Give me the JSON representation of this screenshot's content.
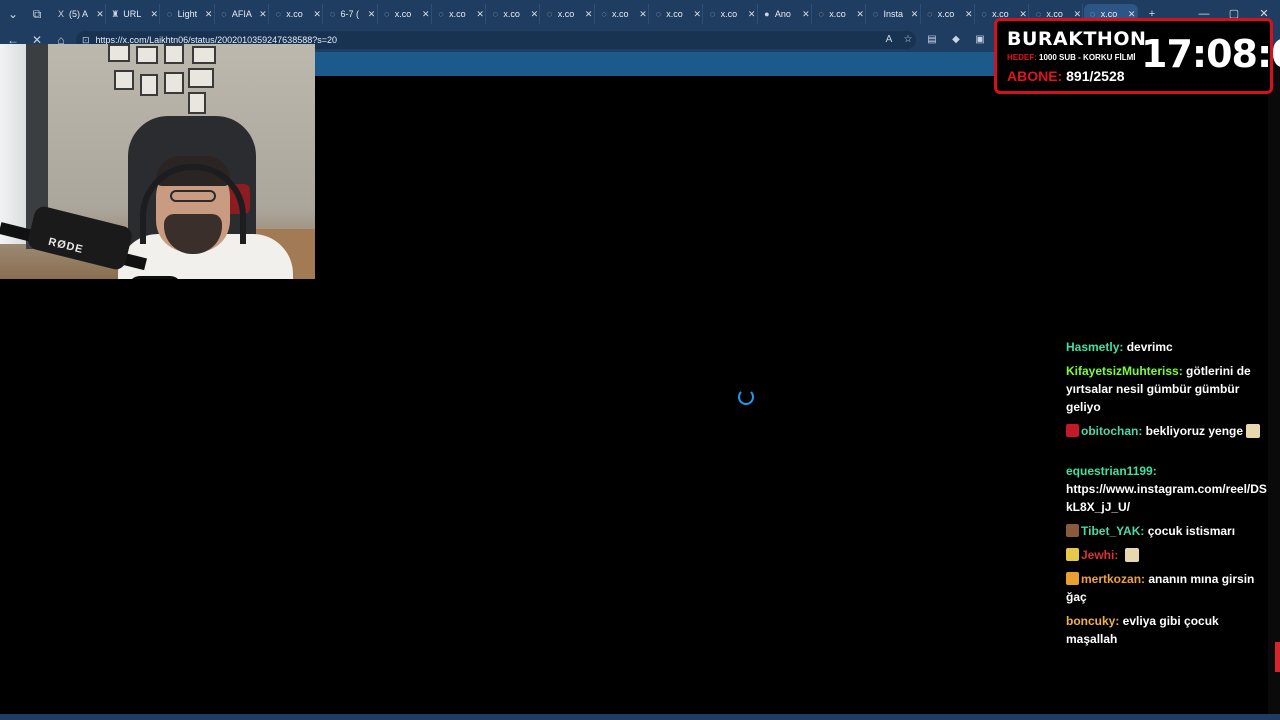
{
  "browser": {
    "tabs": [
      {
        "label": "",
        "icon": "tab-actions-icon"
      },
      {
        "label": "(5) A",
        "icon": "x-logo-icon"
      },
      {
        "label": "URL",
        "icon": "trophy-icon"
      },
      {
        "label": "Light",
        "icon": "loading-icon"
      },
      {
        "label": "AFIA",
        "icon": "loading-icon"
      },
      {
        "label": "x.co",
        "icon": "loading-icon"
      },
      {
        "label": "6-7 (",
        "icon": "loading-icon"
      },
      {
        "label": "x.co",
        "icon": "loading-icon"
      },
      {
        "label": "x.co",
        "icon": "loading-icon"
      },
      {
        "label": "x.co",
        "icon": "loading-icon"
      },
      {
        "label": "x.co",
        "icon": "loading-icon"
      },
      {
        "label": "x.co",
        "icon": "loading-icon"
      },
      {
        "label": "x.co",
        "icon": "loading-icon"
      },
      {
        "label": "x.co",
        "icon": "loading-icon"
      },
      {
        "label": "Ano",
        "icon": "globe-icon"
      },
      {
        "label": "x.co",
        "icon": "loading-icon"
      },
      {
        "label": "Insta",
        "icon": "loading-icon"
      },
      {
        "label": "x.co",
        "icon": "loading-icon"
      },
      {
        "label": "x.co",
        "icon": "loading-icon"
      },
      {
        "label": "x.co",
        "icon": "loading-icon"
      },
      {
        "label": "x.co",
        "icon": "loading-icon"
      }
    ],
    "url": "https://x.com/Laikhtn06/status/2002010359247638588?s=20"
  },
  "timer": {
    "title": "BURAKTHON",
    "goal_label": "HEDEF:",
    "goal_text": "1000 SUB - KORKU FİLMİ",
    "subs_label": "ABONE:",
    "subs_value": "891/2528",
    "clock": "17:08:06"
  },
  "webcam": {
    "mic_brand": "RØDE"
  },
  "chat": [
    {
      "user": "Hasmetly:",
      "text": "devrimc",
      "color": "#3fe0a0",
      "badge": null,
      "emote": false
    },
    {
      "user": "KifayetsizMuhteriss:",
      "text": "götlerini de yırtsalar nesil gümbür gümbür geliyo",
      "color": "#7cfc3c",
      "badge": null,
      "emote": false
    },
    {
      "user": "obitochan:",
      "text": "bekliyoruz yenge",
      "color": "#4fd6a8",
      "badge": "#c21a2a",
      "emote": true
    },
    {
      "user": "equestrian1199:",
      "text": "https://www.instagram.com/reel/DSkL8X_jJ_U/",
      "color": "#3fe0a0",
      "badge": null,
      "emote": false
    },
    {
      "user": "Tibet_YAK:",
      "text": "çocuk istismarı",
      "color": "#4fd6a8",
      "badge": "#8a5a3c",
      "emote": false
    },
    {
      "user": "Jewhi:",
      "text": "",
      "color": "#d8323a",
      "badge": "#e8c84a",
      "emote": true
    },
    {
      "user": "mertkozan:",
      "text": "ananın mına girsin ğaç",
      "color": "#f0a040",
      "badge": "#e8a030",
      "emote": false
    },
    {
      "user": "boncuky:",
      "text": "evliya gibi çocuk maşallah",
      "color": "#f0b050",
      "badge": null,
      "emote": false
    }
  ]
}
